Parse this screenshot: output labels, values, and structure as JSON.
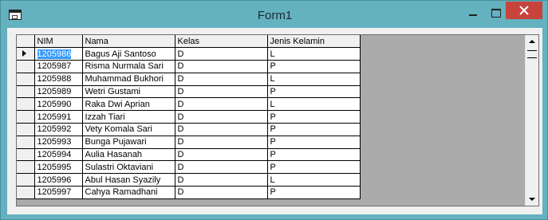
{
  "window": {
    "title": "Form1"
  },
  "grid": {
    "columns": [
      "NIM",
      "Nama",
      "Kelas",
      "Jenis Kelamin"
    ],
    "rows": [
      [
        "1205986",
        "Bagus Aji Santoso",
        "D",
        "L"
      ],
      [
        "1205987",
        "Risma Nurmala Sari",
        "D",
        "P"
      ],
      [
        "1205988",
        "Muhammad Bukhori",
        "D",
        "L"
      ],
      [
        "1205989",
        "Wetri Gustami",
        "D",
        "P"
      ],
      [
        "1205990",
        "Raka Dwi Aprian",
        "D",
        "L"
      ],
      [
        "1205991",
        "Izzah Tiari",
        "D",
        "P"
      ],
      [
        "1205992",
        "Vety Komala Sari",
        "D",
        "P"
      ],
      [
        "1205993",
        "Bunga Pujawari",
        "D",
        "P"
      ],
      [
        "1205994",
        "Aulia Hasanah",
        "D",
        "P"
      ],
      [
        "1205995",
        "Sulastri Oktaviani",
        "D",
        "P"
      ],
      [
        "1205996",
        "Abul Hasan Syazily",
        "D",
        "L"
      ],
      [
        "1205997",
        "Cahya Ramadhani",
        "D",
        "P"
      ]
    ],
    "selected_row": 0,
    "selected_column": 0
  },
  "icons": {
    "app": "form-window-icon",
    "minimize": "minimize-icon",
    "maximize": "maximize-icon",
    "close": "close-icon",
    "row_pointer": "row-pointer-icon",
    "scroll_up": "scroll-up-icon",
    "scroll_down": "scroll-down-icon"
  },
  "colors": {
    "frame": "#64b1bf",
    "close_button": "#c7433b",
    "selection": "#3399ff"
  }
}
